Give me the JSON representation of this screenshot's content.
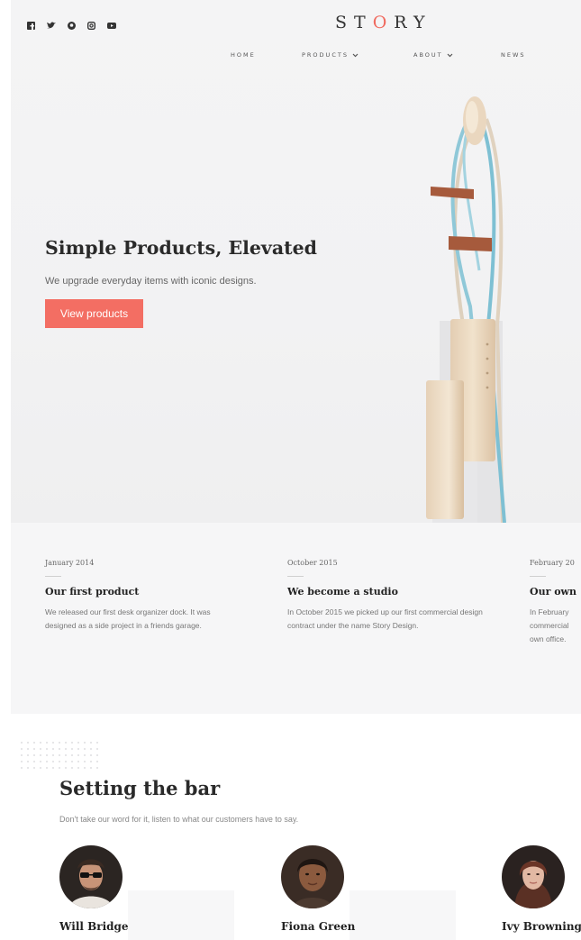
{
  "header": {
    "logo_text": "STORY",
    "logo_accent_color": "#f06a5f",
    "social_icons": [
      "facebook-icon",
      "twitter-icon",
      "pinterest-icon",
      "instagram-icon",
      "youtube-icon"
    ],
    "nav": [
      {
        "label": "HOME",
        "has_dropdown": false
      },
      {
        "label": "PRODUCTS",
        "has_dropdown": true
      },
      {
        "label": "ABOUT",
        "has_dropdown": true
      },
      {
        "label": "NEWS",
        "has_dropdown": false
      }
    ]
  },
  "hero": {
    "title": "Simple Products, Elevated",
    "subtitle": "We upgrade everyday items with iconic designs.",
    "button_label": "View products",
    "button_color": "#f36e63"
  },
  "timeline": [
    {
      "date": "January 2014",
      "title": "Our first product",
      "body": "We released our first desk organizer dock. It was designed as a side project in a friends garage."
    },
    {
      "date": "October 2015",
      "title": "We become a studio",
      "body": "In October 2015 we picked up our first commercial design contract under the name Story Design."
    },
    {
      "date": "February 20",
      "title": "Our own",
      "body": "In February commercial own office."
    }
  ],
  "testimonials": {
    "title": "Setting the bar",
    "subtitle": "Don't take our word for it, listen to what our customers have to say.",
    "people": [
      {
        "name": "Will Bridge"
      },
      {
        "name": "Fiona Green"
      },
      {
        "name": "Ivy Browning"
      }
    ]
  }
}
